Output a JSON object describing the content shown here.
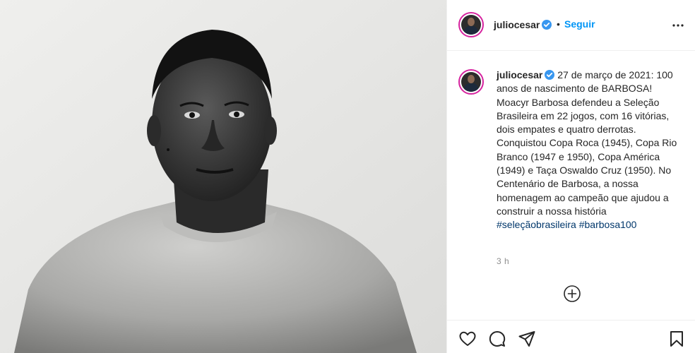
{
  "post": {
    "image_alt": "Black-and-white portrait of Moacyr Barbosa"
  },
  "header": {
    "username": "juliocesar",
    "separator": "•",
    "follow_label": "Seguir"
  },
  "caption": {
    "username": "juliocesar",
    "text_parts": [
      " 27 de março de 2021: 100 anos de nascimento de BARBOSA! Moacyr Barbosa defendeu a Seleção Brasileira em 22 jogos, com 16 vitórias, dois empates e quatro derrotas. Conquistou Copa Roca (1945), Copa Rio Branco (1947 e 1950), Copa América (1949) e Taça Oswaldo Cruz (1950). No Centenário de Barbosa, a nossa homenagem ao campeão que ajudou a construir a nossa história "
    ],
    "hashtags": [
      "#seleçãobrasileira",
      "#barbosa100"
    ],
    "time": "3 h"
  },
  "colors": {
    "link": "#0095f6",
    "hashtag": "#00376b",
    "verified": "#3897f0",
    "muted": "#8e8e8e"
  },
  "icons": {
    "verified": "verified-badge-icon",
    "more": "more-options-icon",
    "add": "add-circle-icon",
    "like": "heart-icon",
    "comment": "comment-icon",
    "share": "share-icon",
    "save": "bookmark-icon"
  }
}
